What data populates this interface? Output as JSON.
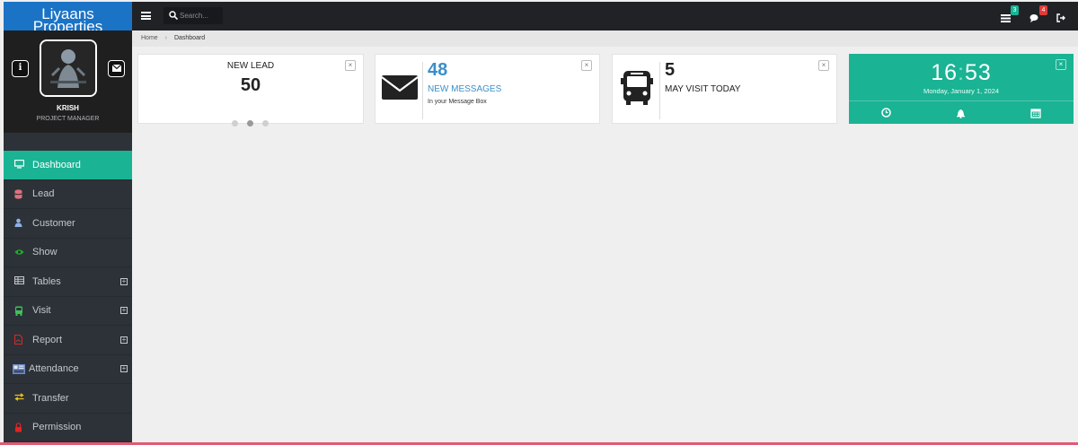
{
  "brand": {
    "line1": "Liyaans",
    "line2": "Properties",
    "color": "#1b73c5"
  },
  "profile": {
    "name": "KRISH",
    "role": "PROJECT MANAGER",
    "info_icon": "info-icon",
    "mail_icon": "envelope-icon"
  },
  "sidebar": {
    "items": [
      {
        "label": "Dashboard",
        "icon": "monitor-icon",
        "active": true,
        "expand": false,
        "icon_color": "#ffffff"
      },
      {
        "label": "Lead",
        "icon": "database-icon",
        "active": false,
        "expand": false,
        "icon_color": "#e0707a"
      },
      {
        "label": "Customer",
        "icon": "user-icon",
        "active": false,
        "expand": false,
        "icon_color": "#8fb0e8"
      },
      {
        "label": "Show",
        "icon": "eye-icon",
        "active": false,
        "expand": false,
        "icon_color": "#1db02d"
      },
      {
        "label": "Tables",
        "icon": "table-icon",
        "active": false,
        "expand": true,
        "icon_color": "#c4c8cc"
      },
      {
        "label": "Visit",
        "icon": "bus-icon",
        "active": false,
        "expand": true,
        "icon_color": "#3ec25a"
      },
      {
        "label": "Report",
        "icon": "pdf-icon",
        "active": false,
        "expand": true,
        "icon_color": "#d12b2b"
      },
      {
        "label": "Attendance",
        "icon": "attendance-icon",
        "active": false,
        "expand": true,
        "icon_color": "#6d8cc8"
      },
      {
        "label": "Transfer",
        "icon": "exchange-icon",
        "active": false,
        "expand": false,
        "icon_color": "#e8c219"
      },
      {
        "label": "Permission",
        "icon": "lock-icon",
        "active": false,
        "expand": false,
        "icon_color": "#e02424"
      }
    ],
    "expand_symbol": "+"
  },
  "topbar": {
    "search_placeholder": "Search...",
    "tasks_badge": "3",
    "messages_badge": "4",
    "tasks_badge_color": "#1ab394",
    "messages_badge_color": "#e03a3a"
  },
  "breadcrumb": {
    "home": "Home",
    "current": "Dashboard",
    "separator": "›"
  },
  "widgets": {
    "lead": {
      "title": "NEW LEAD",
      "value": "50"
    },
    "messages": {
      "value": "48",
      "label": "NEW MESSAGES",
      "sub": "In your Message Box"
    },
    "visits": {
      "value": "5",
      "label": "MAY VISIT TODAY"
    },
    "clock": {
      "hours": "16",
      "minutes": "53",
      "separator": ":",
      "date": "Monday, January 1, 2024",
      "accent": "#1ab394"
    },
    "close_symbol": "×"
  }
}
